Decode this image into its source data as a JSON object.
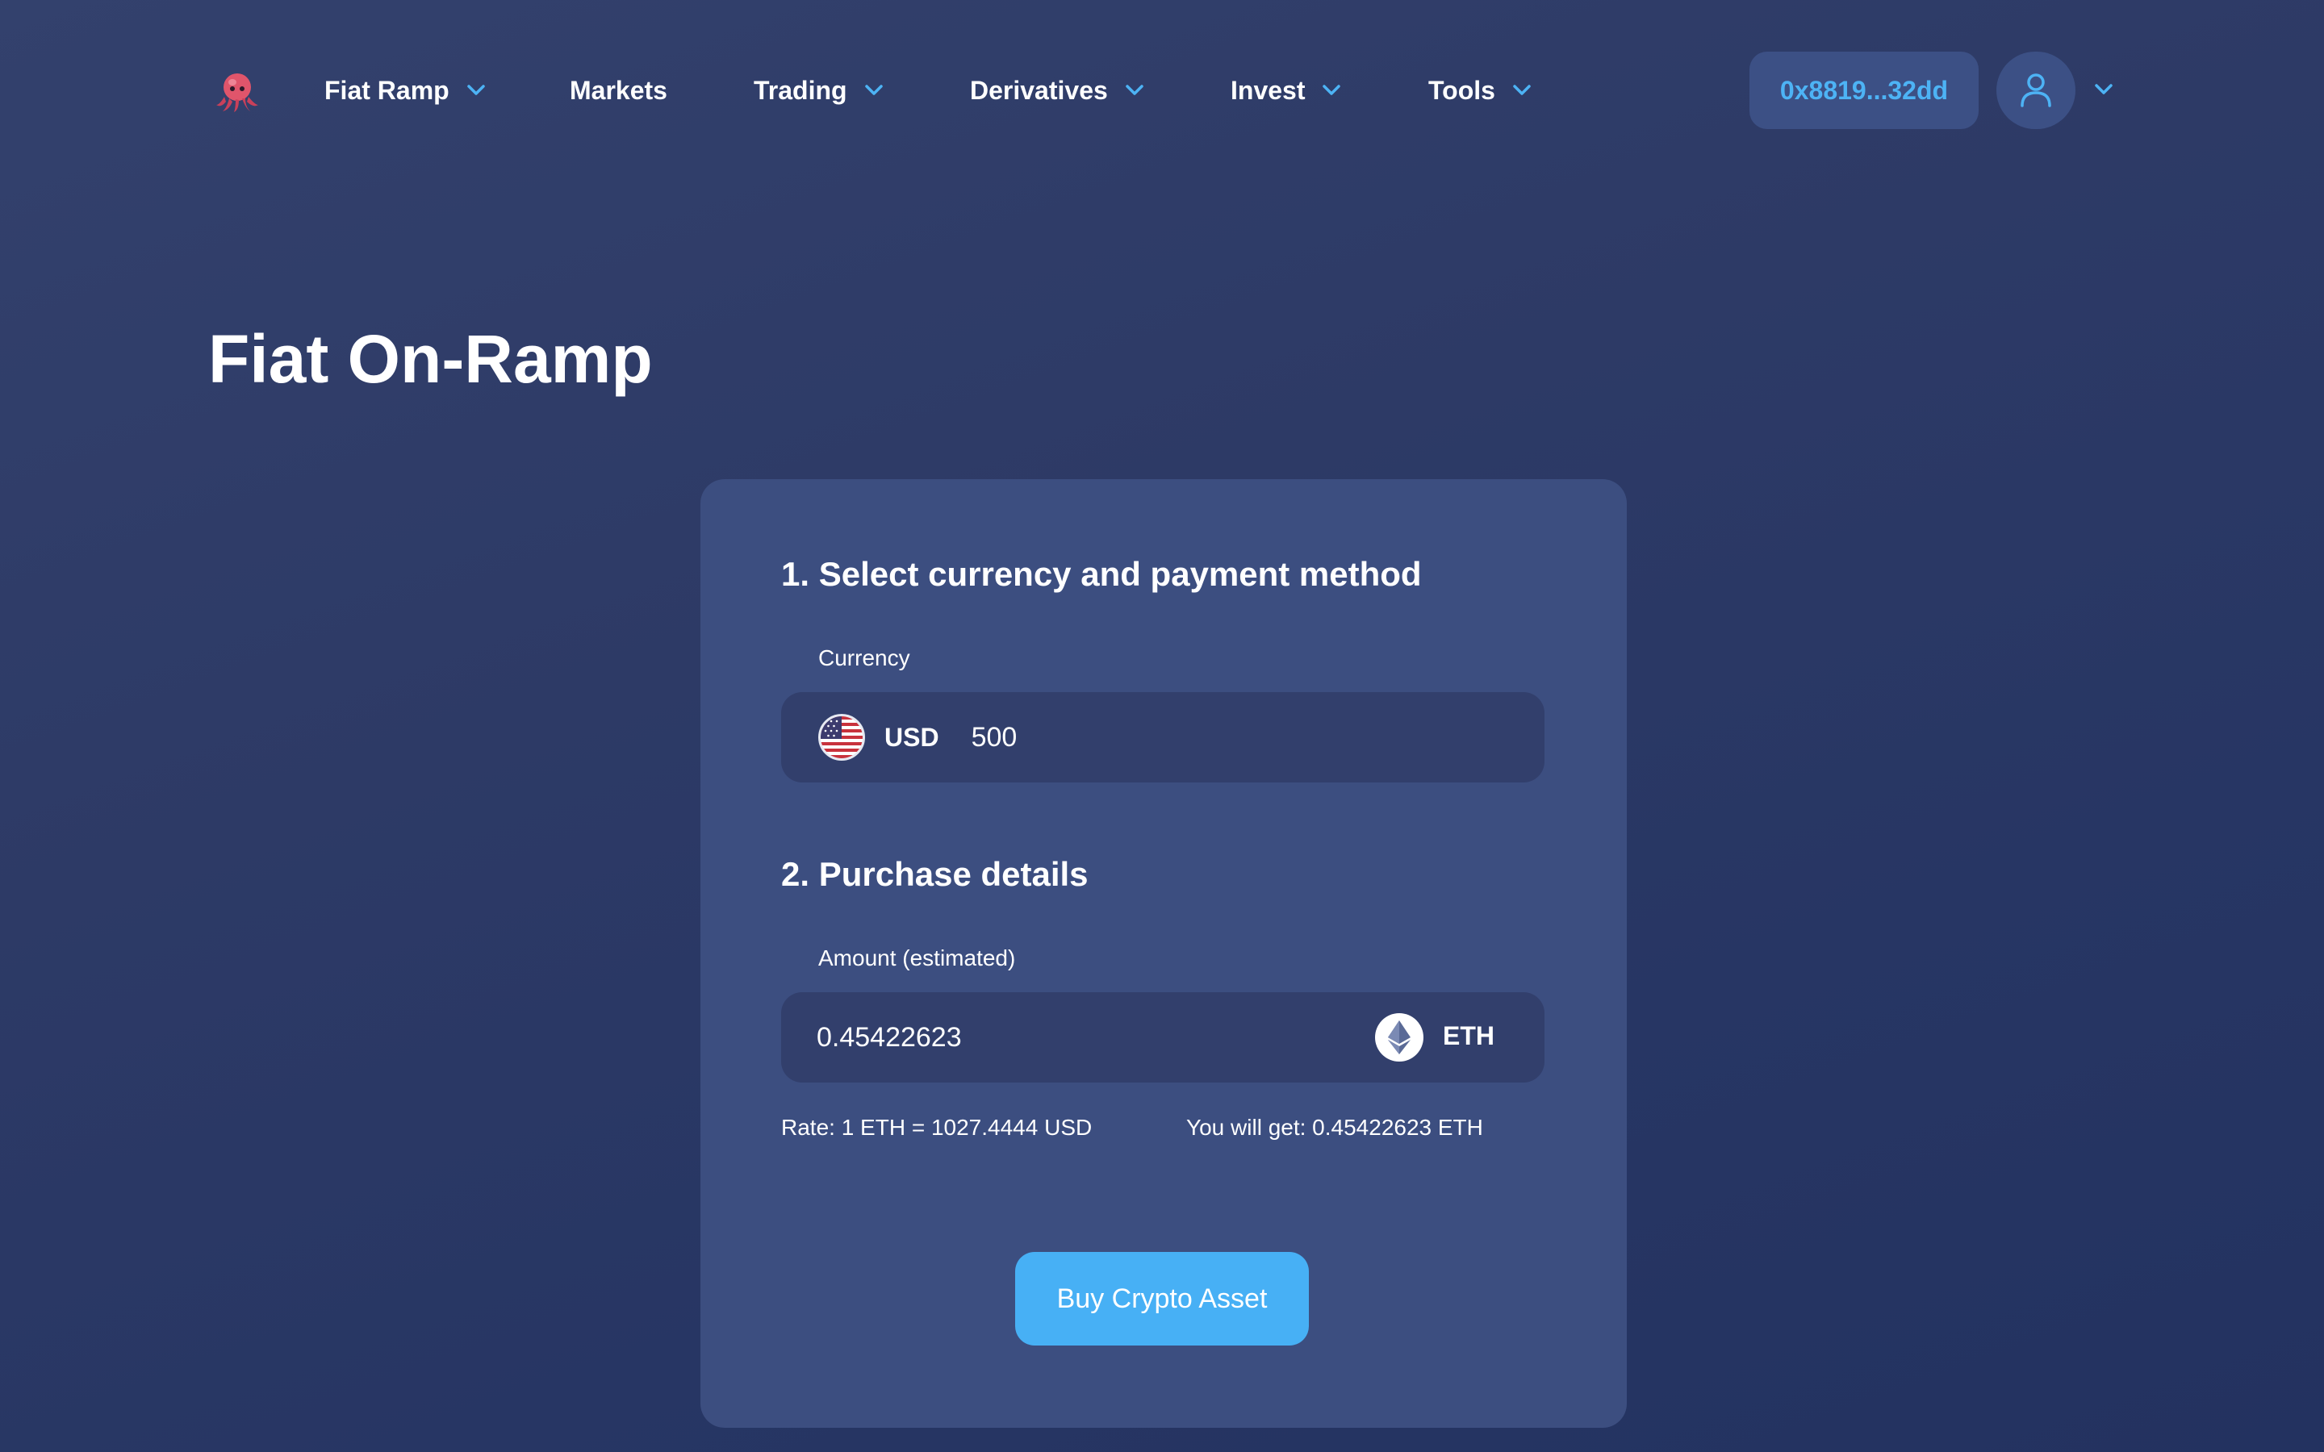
{
  "nav": {
    "logo_icon": "octopus-logo-icon",
    "items": [
      {
        "label": "Fiat Ramp",
        "has_dropdown": true
      },
      {
        "label": "Markets",
        "has_dropdown": false
      },
      {
        "label": "Trading",
        "has_dropdown": true
      },
      {
        "label": "Derivatives",
        "has_dropdown": true
      },
      {
        "label": "Invest",
        "has_dropdown": true
      },
      {
        "label": "Tools",
        "has_dropdown": true
      }
    ],
    "wallet_address": "0x8819...32dd",
    "account_icon": "user-icon",
    "accent_color": "#4db3f5"
  },
  "page": {
    "title": "Fiat On-Ramp"
  },
  "form": {
    "step1_title": "1. Select currency and payment method",
    "currency_label": "Currency",
    "currency_code": "USD",
    "currency_flag_icon": "us-flag-icon",
    "currency_amount": "500",
    "step2_title": "2. Purchase details",
    "amount_label": "Amount (estimated)",
    "amount_value": "0.45422623",
    "asset_code": "ETH",
    "asset_icon": "ethereum-icon",
    "rate_text": "Rate: 1 ETH = 1027.4444 USD",
    "receive_text": "You will get: 0.45422623 ETH",
    "buy_button_label": "Buy Crypto Asset",
    "button_color": "#47b0f5"
  }
}
